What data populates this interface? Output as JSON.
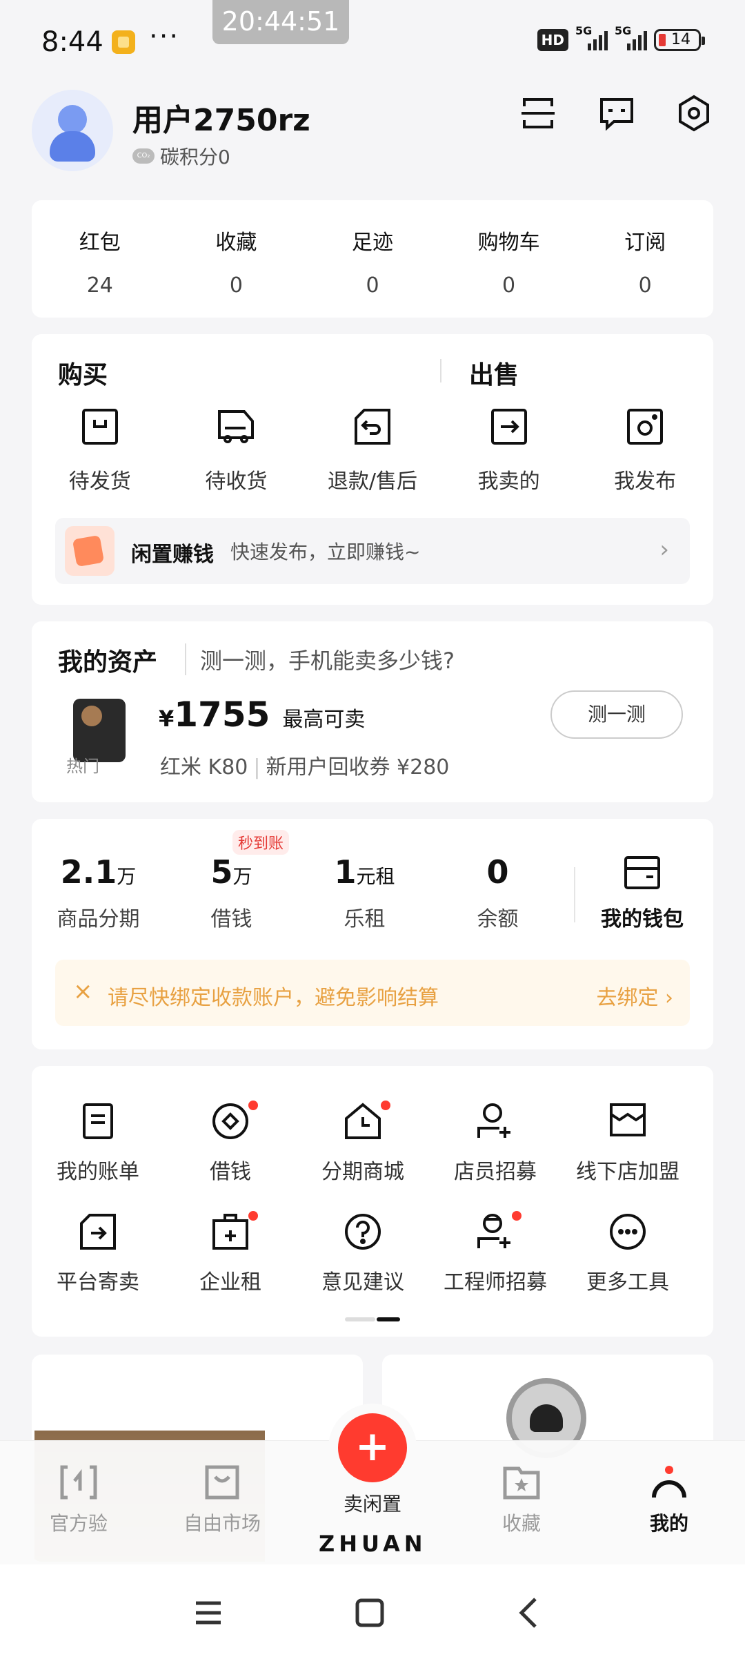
{
  "status_bar": {
    "time": "8:44",
    "clock": "20:44:51",
    "network_1": "5G",
    "network_2": "5G",
    "hd": "HD",
    "battery": "14"
  },
  "user": {
    "name": "用户2750rz",
    "carbon": "碳积分0",
    "co2": "CO₂"
  },
  "stats": [
    {
      "label": "红包",
      "value": "24"
    },
    {
      "label": "收藏",
      "value": "0"
    },
    {
      "label": "足迹",
      "value": "0"
    },
    {
      "label": "购物车",
      "value": "0"
    },
    {
      "label": "订阅",
      "value": "0"
    }
  ],
  "orders": {
    "buy_title": "购买",
    "sell_title": "出售",
    "items": [
      {
        "label": "待发货",
        "icon": "box-icon"
      },
      {
        "label": "待收货",
        "icon": "truck-icon"
      },
      {
        "label": "退款/售后",
        "icon": "return-icon"
      },
      {
        "label": "我卖的",
        "icon": "arrow-box-icon"
      },
      {
        "label": "我发布",
        "icon": "camera-icon"
      }
    ],
    "idle": {
      "title": "闲置赚钱",
      "desc": "快速发布，立即赚钱~"
    }
  },
  "assets": {
    "title": "我的资产",
    "subtitle": "测一测，手机能卖多少钱?",
    "hot": "热门",
    "currency": "¥",
    "price": "1755",
    "price_label": "最高可卖",
    "model": "红米 K80",
    "coupon": "新用户回收券 ¥280",
    "button": "测一测"
  },
  "finance": {
    "items": [
      {
        "value": "2.1",
        "unit": "万",
        "label": "商品分期"
      },
      {
        "value": "5",
        "unit": "万",
        "label": "借钱",
        "badge": "秒到账"
      },
      {
        "value": "1",
        "unit": "元租",
        "label": "乐租"
      },
      {
        "value": "0",
        "unit": "",
        "label": "余额"
      }
    ],
    "wallet": "我的钱包",
    "notice": "请尽快绑定收款账户，避免影响结算",
    "notice_action": "去绑定"
  },
  "tools": {
    "row1": [
      {
        "label": "我的账单"
      },
      {
        "label": "借钱"
      },
      {
        "label": "分期商城"
      },
      {
        "label": "店员招募"
      },
      {
        "label": "线下店加盟"
      }
    ],
    "row2": [
      {
        "label": "平台寄卖"
      },
      {
        "label": "企业租"
      },
      {
        "label": "意见建议"
      },
      {
        "label": "工程师招募"
      },
      {
        "label": "更多工具"
      }
    ]
  },
  "tabbar": {
    "tabs": [
      {
        "label": "官方验"
      },
      {
        "label": "自由市场"
      },
      {
        "label": "收藏"
      },
      {
        "label": "我的"
      }
    ],
    "sell": "卖闲置",
    "brand": "ZHUAN"
  },
  "colors": {
    "accent": "#ff3b2f",
    "notice_text": "#e8a142",
    "notice_bg": "#fff8ec"
  }
}
